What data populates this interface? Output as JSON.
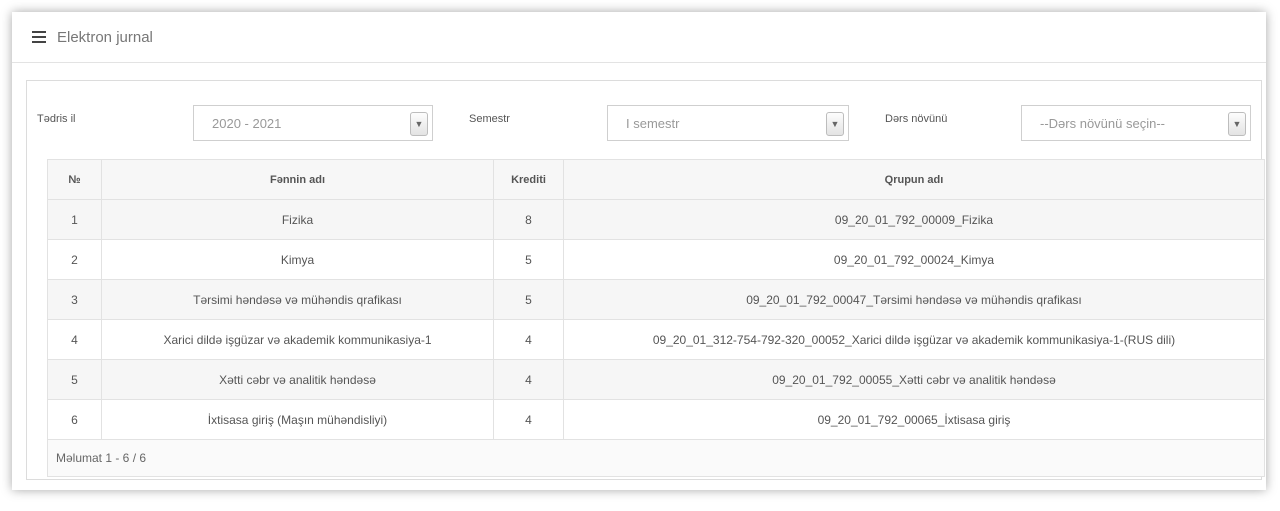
{
  "header": {
    "title": "Elektron jurnal",
    "menu_icon": "hamburger-menu-icon"
  },
  "filters": {
    "year_label": "Tədris il",
    "year_value": "2020 - 2021",
    "semester_label": "Semestr",
    "semester_value": "I semestr",
    "lesson_type_label": "Dərs növünü",
    "lesson_type_value": "--Dərs növünü seçin--"
  },
  "table": {
    "headers": [
      "№",
      "Fənnin adı",
      "Krediti",
      "Qrupun adı"
    ],
    "rows": [
      [
        "1",
        "Fizika",
        "8",
        "09_20_01_792_00009_Fizika"
      ],
      [
        "2",
        "Kimya",
        "5",
        "09_20_01_792_00024_Kimya"
      ],
      [
        "3",
        "Tərsimi həndəsə və mühəndis qrafikası",
        "5",
        "09_20_01_792_00047_Tərsimi həndəsə və mühəndis qrafikası"
      ],
      [
        "4",
        "Xarici dildə işgüzar və akademik kommunikasiya-1",
        "4",
        "09_20_01_312-754-792-320_00052_Xarici dildə işgüzar və akademik kommunikasiya-1-(RUS dili)"
      ],
      [
        "5",
        "Xətti cəbr və analitik həndəsə",
        "4",
        "09_20_01_792_00055_Xətti cəbr və analitik həndəsə"
      ],
      [
        "6",
        "İxtisasa giriş (Maşın mühəndisliyi)",
        "4",
        "09_20_01_792_00065_İxtisasa giriş"
      ]
    ]
  },
  "footer": {
    "info": "Məlumat 1 - 6 / 6"
  }
}
